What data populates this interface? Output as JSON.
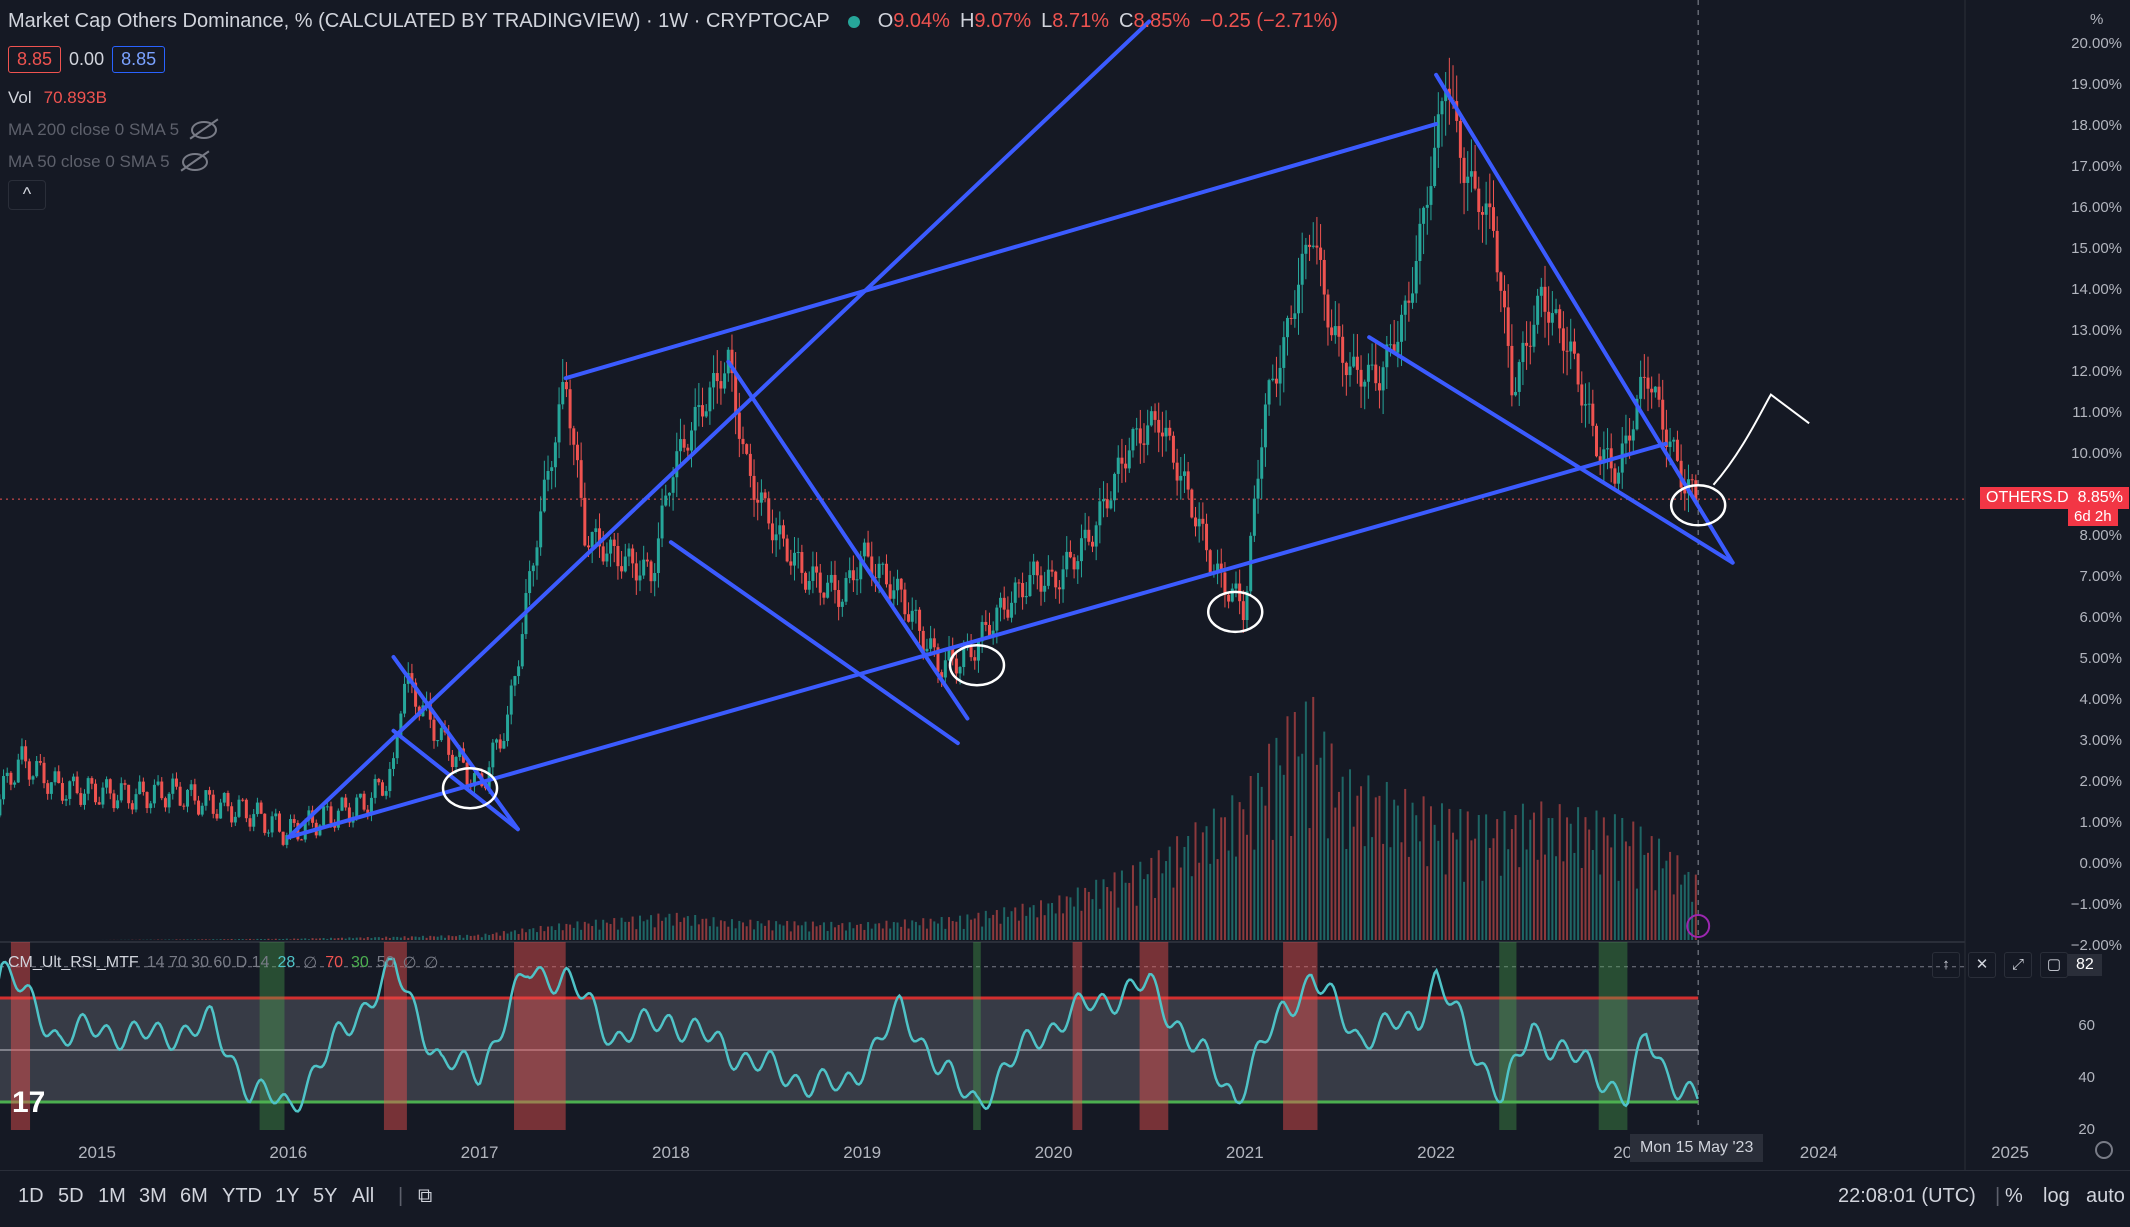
{
  "header": {
    "title": "Market Cap Others Dominance, % (CALCULATED BY TRADINGVIEW) · 1W · CRYPTOCAP",
    "ohlc": [
      {
        "k": "O",
        "v": "9.04%"
      },
      {
        "k": "H",
        "v": "9.07%"
      },
      {
        "k": "L",
        "v": "8.71%"
      },
      {
        "k": "C",
        "v": "8.85%"
      }
    ],
    "change": "−0.25 (−2.71%)",
    "values": {
      "a": "8.85",
      "b": "0.00",
      "c": "8.85"
    },
    "vol_label": "Vol",
    "vol_value": "70.893B",
    "ma200": "MA 200 close 0 SMA 5",
    "ma50": "MA 50 close 0 SMA 5",
    "collapse": "^"
  },
  "chart_data": {
    "type": "line",
    "title": "Market Cap Others Dominance, % (CALCULATED BY TRADINGVIEW) · 1W · CRYPTOCAP",
    "xlabel": "",
    "ylabel": "",
    "x_ticks": [
      "2015",
      "2016",
      "2017",
      "2018",
      "2019",
      "2020",
      "2021",
      "2022",
      "202",
      "2024",
      "2025"
    ],
    "y_unit": "%",
    "y_ticks": [
      "20.00%",
      "19.00%",
      "18.00%",
      "17.00%",
      "16.00%",
      "15.00%",
      "14.00%",
      "13.00%",
      "12.00%",
      "11.00%",
      "10.00%",
      "8.00%",
      "7.00%",
      "6.00%",
      "5.00%",
      "4.00%",
      "3.00%",
      "2.00%",
      "1.00%",
      "0.00%",
      "−1.00%",
      "−2.00%"
    ],
    "ylim": [
      -2,
      20
    ],
    "series": [
      {
        "name": "OTHERS.D",
        "x": [
          2014.3,
          2014.45,
          2014.6,
          2014.8,
          2015.0,
          2015.2,
          2015.4,
          2015.6,
          2015.8,
          2016.0,
          2016.2,
          2016.4,
          2016.55,
          2016.6,
          2016.8,
          2017.0,
          2017.15,
          2017.3,
          2017.45,
          2017.55,
          2017.7,
          2017.9,
          2018.0,
          2018.15,
          2018.3,
          2018.4,
          2018.55,
          2018.7,
          2018.9,
          2019.0,
          2019.2,
          2019.4,
          2019.55,
          2019.7,
          2019.9,
          2020.0,
          2020.2,
          2020.4,
          2020.55,
          2020.7,
          2020.85,
          2021.0,
          2021.1,
          2021.2,
          2021.35,
          2021.45,
          2021.55,
          2021.7,
          2021.85,
          2022.0,
          2022.05,
          2022.15,
          2022.3,
          2022.4,
          2022.55,
          2022.7,
          2022.85,
          2022.95,
          2023.1,
          2023.2,
          2023.3,
          2023.37
        ],
        "values": [
          0.8,
          1.3,
          2.5,
          1.8,
          1.7,
          1.6,
          1.7,
          1.4,
          1.2,
          0.7,
          1.1,
          1.4,
          2.2,
          4.5,
          3.0,
          1.8,
          3.5,
          8.0,
          11.8,
          8.0,
          7.5,
          7.0,
          9.5,
          11.0,
          12.2,
          9.5,
          8.0,
          7.0,
          6.5,
          7.5,
          6.5,
          4.8,
          5.0,
          6.0,
          7.0,
          6.8,
          8.0,
          10.2,
          10.8,
          9.0,
          7.0,
          6.2,
          11.0,
          12.5,
          15.5,
          13.0,
          12.0,
          11.8,
          13.5,
          17.5,
          19.2,
          16.8,
          15.5,
          11.5,
          13.8,
          12.5,
          10.0,
          9.5,
          12.0,
          10.5,
          9.2,
          8.85
        ]
      },
      {
        "name": "CM_Ult_RSI_MTF",
        "x": [
          2014.3,
          2014.5,
          2014.8,
          2015.0,
          2015.3,
          2015.6,
          2015.8,
          2016.0,
          2016.3,
          2016.55,
          2016.8,
          2017.0,
          2017.25,
          2017.45,
          2017.7,
          2018.0,
          2018.3,
          2018.6,
          2018.9,
          2019.2,
          2019.5,
          2019.6,
          2019.9,
          2020.2,
          2020.5,
          2020.7,
          2020.95,
          2021.2,
          2021.35,
          2021.6,
          2021.9,
          2022.0,
          2022.2,
          2022.35,
          2022.5,
          2022.7,
          2022.9,
          2023.0,
          2023.1,
          2023.2,
          2023.37
        ],
        "values": [
          45,
          82,
          55,
          58,
          55,
          60,
          35,
          28,
          58,
          82,
          45,
          42,
          80,
          78,
          55,
          62,
          50,
          40,
          35,
          65,
          35,
          30,
          55,
          68,
          75,
          55,
          32,
          65,
          78,
          55,
          62,
          78,
          50,
          32,
          58,
          48,
          38,
          32,
          55,
          42,
          30
        ]
      }
    ],
    "volume": {
      "x": [
        2014.3,
        2015.0,
        2016.0,
        2016.55,
        2017.0,
        2017.45,
        2018.0,
        2018.3,
        2019.0,
        2019.5,
        2020.0,
        2020.5,
        2021.0,
        2021.2,
        2021.35,
        2021.5,
        2022.0,
        2022.3,
        2022.5,
        2023.0,
        2023.2,
        2023.37
      ],
      "values": [
        0.0,
        0.0,
        0.02,
        0.05,
        0.08,
        0.25,
        0.4,
        0.3,
        0.25,
        0.35,
        0.6,
        1.2,
        2.2,
        3.2,
        3.6,
        2.5,
        2.0,
        1.8,
        2.0,
        1.8,
        1.4,
        0.9
      ]
    },
    "rsi_ticks": [
      "82",
      "60",
      "40",
      "20"
    ],
    "rsi_levels": {
      "upper": 70,
      "mid": 50,
      "lower": 30
    },
    "trendlines": [
      {
        "x": [
          2016.0,
          2020.5
        ],
        "y": [
          0.6,
          20.5
        ]
      },
      {
        "x": [
          2017.45,
          2022.0
        ],
        "y": [
          11.8,
          18.0
        ]
      },
      {
        "x": [
          2022.0,
          2023.55
        ],
        "y": [
          19.2,
          7.3
        ]
      },
      {
        "x": [
          2021.65,
          2023.55
        ],
        "y": [
          12.8,
          7.3
        ]
      },
      {
        "x": [
          2018.3,
          2019.55
        ],
        "y": [
          12.2,
          3.5
        ]
      },
      {
        "x": [
          2018.0,
          2019.5
        ],
        "y": [
          7.8,
          2.9
        ]
      },
      {
        "x": [
          2016.55,
          2017.2
        ],
        "y": [
          5.0,
          0.8
        ]
      },
      {
        "x": [
          2016.55,
          2017.2
        ],
        "y": [
          3.2,
          0.8
        ]
      },
      {
        "x": [
          2016.0,
          2023.2
        ],
        "y": [
          0.6,
          10.2
        ]
      }
    ],
    "last_price_label": "OTHERS.D",
    "last_price": "8.85%",
    "countdown": "6d 2h",
    "rsi_last": "82",
    "crosshair_date": "Mon 15 May '23"
  },
  "rsi_label": {
    "name": "CM_Ult_RSI_MTF",
    "params": "14 70 30 60 D 14",
    "v1": "28",
    "v2": "∅",
    "v3": "70",
    "v4": "30",
    "v5": "50",
    "v6": "∅",
    "v7": "∅"
  },
  "colors": {
    "bg": "#151924",
    "trend": "#3b5bff",
    "up": "#26a69a",
    "down": "#ef5350",
    "rsi": "#4fc3c7",
    "upper": "#d32f2f",
    "lower": "#4caf50"
  },
  "toolbar": {
    "ranges": [
      "1D",
      "5D",
      "1M",
      "3M",
      "6M",
      "YTD",
      "1Y",
      "5Y",
      "All"
    ],
    "time": "22:08:01 (UTC)",
    "pct": "%",
    "log": "log",
    "auto": "auto"
  }
}
